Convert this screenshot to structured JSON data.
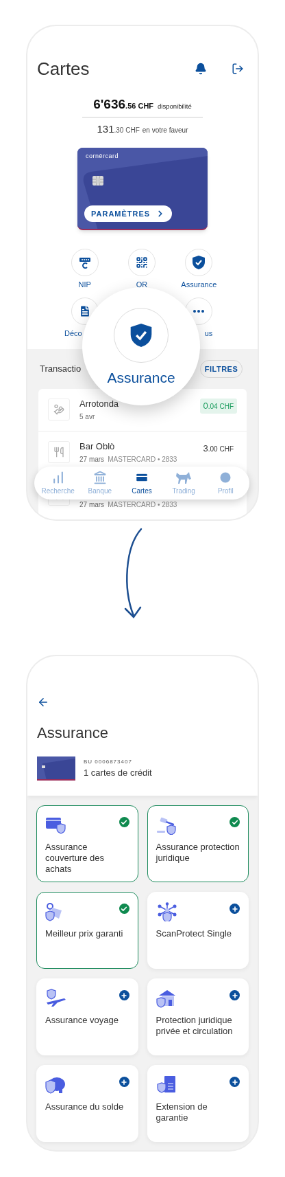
{
  "top_screen": {
    "title": "Cartes",
    "balance": {
      "amount": "6'636",
      "cents": ".56",
      "currency": "CHF",
      "label": "disponibilité"
    },
    "credit": {
      "amount": "131",
      "cents": ".30",
      "currency": "CHF",
      "label": "en votre faveur"
    },
    "card": {
      "brand": "cornērcard",
      "button": "PARAMÈTRES"
    },
    "actions": [
      {
        "label": "NIP"
      },
      {
        "label": "QR"
      },
      {
        "label": "Assurance"
      },
      {
        "label": "Déco"
      },
      {
        "label": "us"
      }
    ],
    "magnifier": {
      "label": "Assurance"
    },
    "transactions": {
      "title": "Transactio",
      "filter_button": "FILTRES",
      "rows": [
        {
          "kind": "credit",
          "name": "Arrotonda",
          "date": "5 avr",
          "amount": "0",
          "cents": ".04",
          "currency": "CHF"
        },
        {
          "kind": "debit",
          "name": "Bar Oblò",
          "date": "27 mars",
          "card": "MASTERCARD • 2833",
          "amount": "3",
          "cents": ".00",
          "currency": "CHF"
        },
        {
          "kind": "debit",
          "date": "27 mars",
          "card": "MASTERCARD • 2833"
        }
      ]
    },
    "bottom_nav": [
      {
        "label": "Recherche",
        "selected": false
      },
      {
        "label": "Banque",
        "selected": false
      },
      {
        "label": "Cartes",
        "selected": true
      },
      {
        "label": "Trading",
        "selected": false
      },
      {
        "label": "Profil",
        "selected": false
      }
    ]
  },
  "bottom_screen": {
    "title": "Assurance",
    "account": {
      "number": "BU 0006873407",
      "summary": "1 cartes de crédit"
    },
    "products": [
      {
        "name": "Assurance couverture des achats",
        "subscribed": true
      },
      {
        "name": "Assurance protection juridique",
        "subscribed": true
      },
      {
        "name": "Meilleur prix garanti",
        "subscribed": true
      },
      {
        "name": "ScanProtect Single",
        "subscribed": false
      },
      {
        "name": "Assurance voyage",
        "subscribed": false
      },
      {
        "name": "Protection juridique privée et circulation",
        "subscribed": false
      },
      {
        "name": "Assurance du solde",
        "subscribed": false
      },
      {
        "name": "Extension de garantie",
        "subscribed": false
      }
    ]
  }
}
